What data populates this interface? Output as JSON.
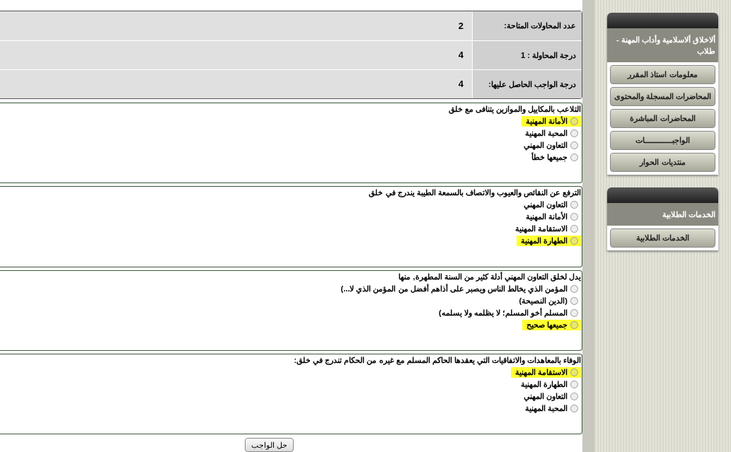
{
  "summary": [
    {
      "label": "عدد المحاولات المتاحة:",
      "value": "2"
    },
    {
      "label": "درجة المحاولة : 1",
      "value": "4"
    },
    {
      "label": "درجة الواجب الحاصل عليها:",
      "value": "4"
    }
  ],
  "questions": [
    {
      "text": "التلاعب بالمكاييل والموازين يتنافى مع خلق",
      "options": [
        {
          "label": "الأمانة المهنية",
          "highlighted": true,
          "selected": false
        },
        {
          "label": "المحبة المهنية",
          "highlighted": false,
          "selected": false
        },
        {
          "label": "التعاون المهني",
          "highlighted": false,
          "selected": false
        },
        {
          "label": "جميعها خطأ",
          "highlighted": false,
          "selected": false
        }
      ]
    },
    {
      "text": "الترفع عن النقائص والعيوب والاتصاف بالسمعة الطيبة يندرج في خلق",
      "options": [
        {
          "label": "التعاون المهني",
          "highlighted": false,
          "selected": false
        },
        {
          "label": "الأمانة المهنية",
          "highlighted": false,
          "selected": false
        },
        {
          "label": "الاستقامة المهنية",
          "highlighted": false,
          "selected": false
        },
        {
          "label": "الطهارة المهنية",
          "highlighted": true,
          "selected": false
        }
      ]
    },
    {
      "text": "يدل لخلق التعاون المهني أدلة كثير من السنة المطهرة, منها",
      "options": [
        {
          "label": "المؤمن الذي يخالط الناس ويصبر على أذاهم أفضل من المؤمن الذي لا...)",
          "highlighted": false,
          "selected": false
        },
        {
          "label": "(الدين النصيحة)",
          "highlighted": false,
          "selected": false
        },
        {
          "label": "المسلم أخو المسلم؛ لا يظلمه ولا يسلمه)",
          "highlighted": false,
          "selected": false
        },
        {
          "label": "جميعها صحيح",
          "highlighted": true,
          "selected": false
        }
      ]
    },
    {
      "text": "الوفاء بالمعاهدات والاتفاقيات التي يعقدها الحاكم المسلم مع غيره من الحكام تندرج في خلق:",
      "options": [
        {
          "label": "الاستقامة المهنية",
          "highlighted": true,
          "selected": false
        },
        {
          "label": "الطهارة المهنية",
          "highlighted": false,
          "selected": false
        },
        {
          "label": "التعاون المهني",
          "highlighted": false,
          "selected": false
        },
        {
          "label": "المحبة المهنية",
          "highlighted": false,
          "selected": false
        }
      ]
    }
  ],
  "submit_button": "حل الواجب",
  "sidebar": [
    {
      "title": "ألاخلاق ألاسلامية وأداب المهنة - طلاب",
      "buttons": [
        "معلومات استاذ المقرر",
        "المحاضرات المسجلة والمحتوى",
        "المحاضرات المباشرة",
        "الواجبـــــــــــــات",
        "منتديات الحوار"
      ]
    },
    {
      "title": "الخدمات الطلابية",
      "buttons": [
        "الخدمات الطلابية"
      ]
    }
  ]
}
